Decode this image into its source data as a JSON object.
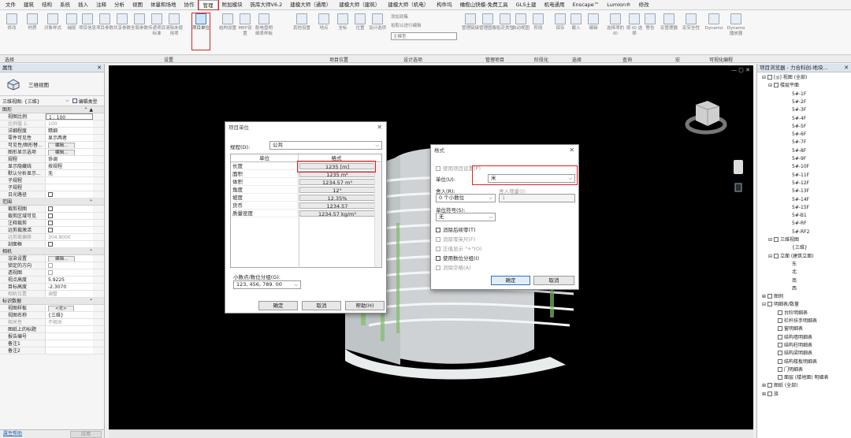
{
  "menubar": {
    "tabs": [
      "文件",
      "建筑",
      "结构",
      "系统",
      "插入",
      "注释",
      "分析",
      "视图",
      "体量和场地",
      "协作",
      "管理",
      "附加模块",
      "族库大师V6.2",
      "建模大师（通用）",
      "建模大师（建筑）",
      "建模大师（机电）",
      "构件坞",
      "橄榄山快模-免费工具",
      "GLS土建",
      "机电通用",
      "Enscape™",
      "Lumion®",
      "修改"
    ],
    "active_tab": "管理"
  },
  "ribbon": {
    "buttons": [
      "修改",
      "材质",
      "对象样式",
      "捕捉",
      "项目信息",
      "项目参数",
      "共享参数",
      "全局参数",
      "传递项目标准",
      "清除未使用项",
      "项目单位",
      "结构设置",
      "MEP设置",
      "配电盘明细表样板",
      "其他设置",
      "地点",
      "坐标",
      "位置",
      "设计选项",
      "管理链接",
      "管理图像",
      "贴花类型",
      "启动视图",
      "阶段",
      "保存",
      "载入",
      "编辑",
      "选择项的 ID",
      "按 ID 选择",
      "警告",
      "宏管理器",
      "宏安全性",
      "Dynamo",
      "Dynamo 播放器"
    ],
    "small_items": [
      "添加到集",
      "拾取以进行编辑",
      "主模型"
    ],
    "panels": [
      "选择",
      "设置",
      "项目位置",
      "设计选项",
      "管理项目",
      "阶段化",
      "选择",
      "查询",
      "宏",
      "可视化编程"
    ]
  },
  "properties": {
    "title": "属性",
    "type_name": "三维视图",
    "instance_selector": "三维视图: {三维}",
    "edit_type": "编辑类型",
    "groups": [
      {
        "name": "图形",
        "rows": [
          {
            "k": "视图比例",
            "v": "1 : 100",
            "kind": "field"
          },
          {
            "k": "比例值 1:",
            "v": "100",
            "kind": "dim"
          },
          {
            "k": "详细程度",
            "v": "精细"
          },
          {
            "k": "零件可见性",
            "v": "显示两者"
          },
          {
            "k": "可见性/图形替...",
            "v": "编辑...",
            "kind": "button"
          },
          {
            "k": "图形显示选项",
            "v": "编辑...",
            "kind": "button"
          },
          {
            "k": "规程",
            "v": "协调"
          },
          {
            "k": "显示隐藏线",
            "v": "按规程"
          },
          {
            "k": "默认分析显示...",
            "v": "无"
          },
          {
            "k": "子规程",
            "v": ""
          },
          {
            "k": "子规程",
            "v": ""
          },
          {
            "k": "日光路径",
            "v": "",
            "kind": "check"
          }
        ]
      },
      {
        "name": "范围",
        "rows": [
          {
            "k": "裁剪视图",
            "v": "",
            "kind": "check"
          },
          {
            "k": "裁剪区域可见",
            "v": "",
            "kind": "check"
          },
          {
            "k": "注释裁剪",
            "v": "",
            "kind": "check"
          },
          {
            "k": "远剪裁激活",
            "v": "",
            "kind": "check"
          },
          {
            "k": "远剪裁偏移",
            "v": "304.8000",
            "kind": "dim"
          },
          {
            "k": "剖面框",
            "v": "",
            "kind": "check"
          }
        ]
      },
      {
        "name": "相机",
        "rows": [
          {
            "k": "渲染设置",
            "v": "编辑...",
            "kind": "button"
          },
          {
            "k": "锁定的方向",
            "v": "",
            "kind": "checkdim"
          },
          {
            "k": "透视图",
            "v": "",
            "kind": "checkdim"
          },
          {
            "k": "视点高度",
            "v": "5.9225"
          },
          {
            "k": "目标高度",
            "v": "-2.3070"
          },
          {
            "k": "相机位置",
            "v": "调整",
            "kind": "dim"
          }
        ]
      },
      {
        "name": "标识数据",
        "rows": [
          {
            "k": "视图样板",
            "v": "<无>",
            "kind": "button"
          },
          {
            "k": "视图名称",
            "v": "{三维}"
          },
          {
            "k": "相关性",
            "v": "不相关",
            "kind": "dim"
          },
          {
            "k": "图纸上的标题",
            "v": ""
          },
          {
            "k": "报告编号",
            "v": ""
          },
          {
            "k": "备注1",
            "v": ""
          },
          {
            "k": "备注2",
            "v": ""
          }
        ]
      }
    ],
    "help_link": "属性帮助",
    "apply": "应用"
  },
  "browser": {
    "title": "项目浏览器 - 力合科创-地块...",
    "items": [
      {
        "t": "[◎] 视图 (全部)",
        "level": 0,
        "tg": "⊟"
      },
      {
        "t": "楼层平面",
        "level": 1,
        "tg": "⊟"
      },
      {
        "t": "5#-1F",
        "level": 3
      },
      {
        "t": "5#-2F",
        "level": 3
      },
      {
        "t": "5#-3F",
        "level": 3
      },
      {
        "t": "5#-4F",
        "level": 3
      },
      {
        "t": "5#-5F",
        "level": 3
      },
      {
        "t": "5#-6F",
        "level": 3
      },
      {
        "t": "5#-7F",
        "level": 3
      },
      {
        "t": "5#-8F",
        "level": 3
      },
      {
        "t": "5#-9F",
        "level": 3
      },
      {
        "t": "5#-10F",
        "level": 3
      },
      {
        "t": "5#-11F",
        "level": 3
      },
      {
        "t": "5#-12F",
        "level": 3
      },
      {
        "t": "5#-13F",
        "level": 3
      },
      {
        "t": "5#-14F",
        "level": 3
      },
      {
        "t": "5#-15F",
        "level": 3
      },
      {
        "t": "5#-B1",
        "level": 3
      },
      {
        "t": "5#-RF",
        "level": 3
      },
      {
        "t": "5#-RF2",
        "level": 3
      },
      {
        "t": "三维视图",
        "level": 1,
        "tg": "⊟"
      },
      {
        "t": "{三维}",
        "level": 3
      },
      {
        "t": "立面 (建筑立面)",
        "level": 1,
        "tg": "⊟"
      },
      {
        "t": "东",
        "level": 3
      },
      {
        "t": "北",
        "level": 3
      },
      {
        "t": "南",
        "level": 3
      },
      {
        "t": "西",
        "level": 3
      },
      {
        "t": "图例",
        "level": 0,
        "tg": "⊞"
      },
      {
        "t": "明细表/数量",
        "level": 0,
        "tg": "⊟"
      },
      {
        "t": "台阶明细表",
        "level": 2
      },
      {
        "t": "栏杆扶手明细表",
        "level": 2
      },
      {
        "t": "窗明细表",
        "level": 2
      },
      {
        "t": "结构墙明细表",
        "level": 2
      },
      {
        "t": "结构柱明细表",
        "level": 2
      },
      {
        "t": "结构梁明细表",
        "level": 2
      },
      {
        "t": "结构楼板明细表",
        "level": 2
      },
      {
        "t": "门明细表",
        "level": 2
      },
      {
        "t": "面层 (楼地面) 明细表",
        "level": 2
      },
      {
        "t": "图纸 (全部)",
        "level": 0,
        "tg": "⊞"
      },
      {
        "t": "族",
        "level": 0,
        "tg": "⊞"
      }
    ]
  },
  "units_dialog": {
    "title": "项目单位",
    "discipline_label": "规程(D):",
    "discipline_value": "公共",
    "col_unit": "单位",
    "col_format": "格式",
    "rows": [
      {
        "unit": "长度",
        "format": "1235 [m]"
      },
      {
        "unit": "面积",
        "format": "1235 m²"
      },
      {
        "unit": "体积",
        "format": "1234.57 m³"
      },
      {
        "unit": "角度",
        "format": "12°"
      },
      {
        "unit": "坡度",
        "format": "12.35%"
      },
      {
        "unit": "货币",
        "format": "1234.57"
      },
      {
        "unit": "质量密度",
        "format": "1234.57 kg/m³"
      }
    ],
    "grouping_label": "小数点/数位分组(G):",
    "grouping_value": "123, 456, 789. 00",
    "ok": "确定",
    "cancel": "取消",
    "help": "帮助(H)"
  },
  "format_dialog": {
    "title": "格式",
    "use_project": "使用项目设置(P)",
    "units_label": "单位(U):",
    "units_value": "米",
    "rounding_label": "舍入(R):",
    "rounding_value": "0 个小数位",
    "increment_label": "舍入增量(I):",
    "increment_value": "1",
    "symbol_label": "单位符号(S):",
    "symbol_value": "无",
    "opt_trailing": "消除后续零(T)",
    "opt_zero_feet": "消除零英尺(F)",
    "opt_plus": "正值显示 \"+\"(O)",
    "opt_grouping": "使用数位分组(I)",
    "opt_spaces": "消除空格(A)",
    "ok": "确定",
    "cancel": "取消"
  }
}
